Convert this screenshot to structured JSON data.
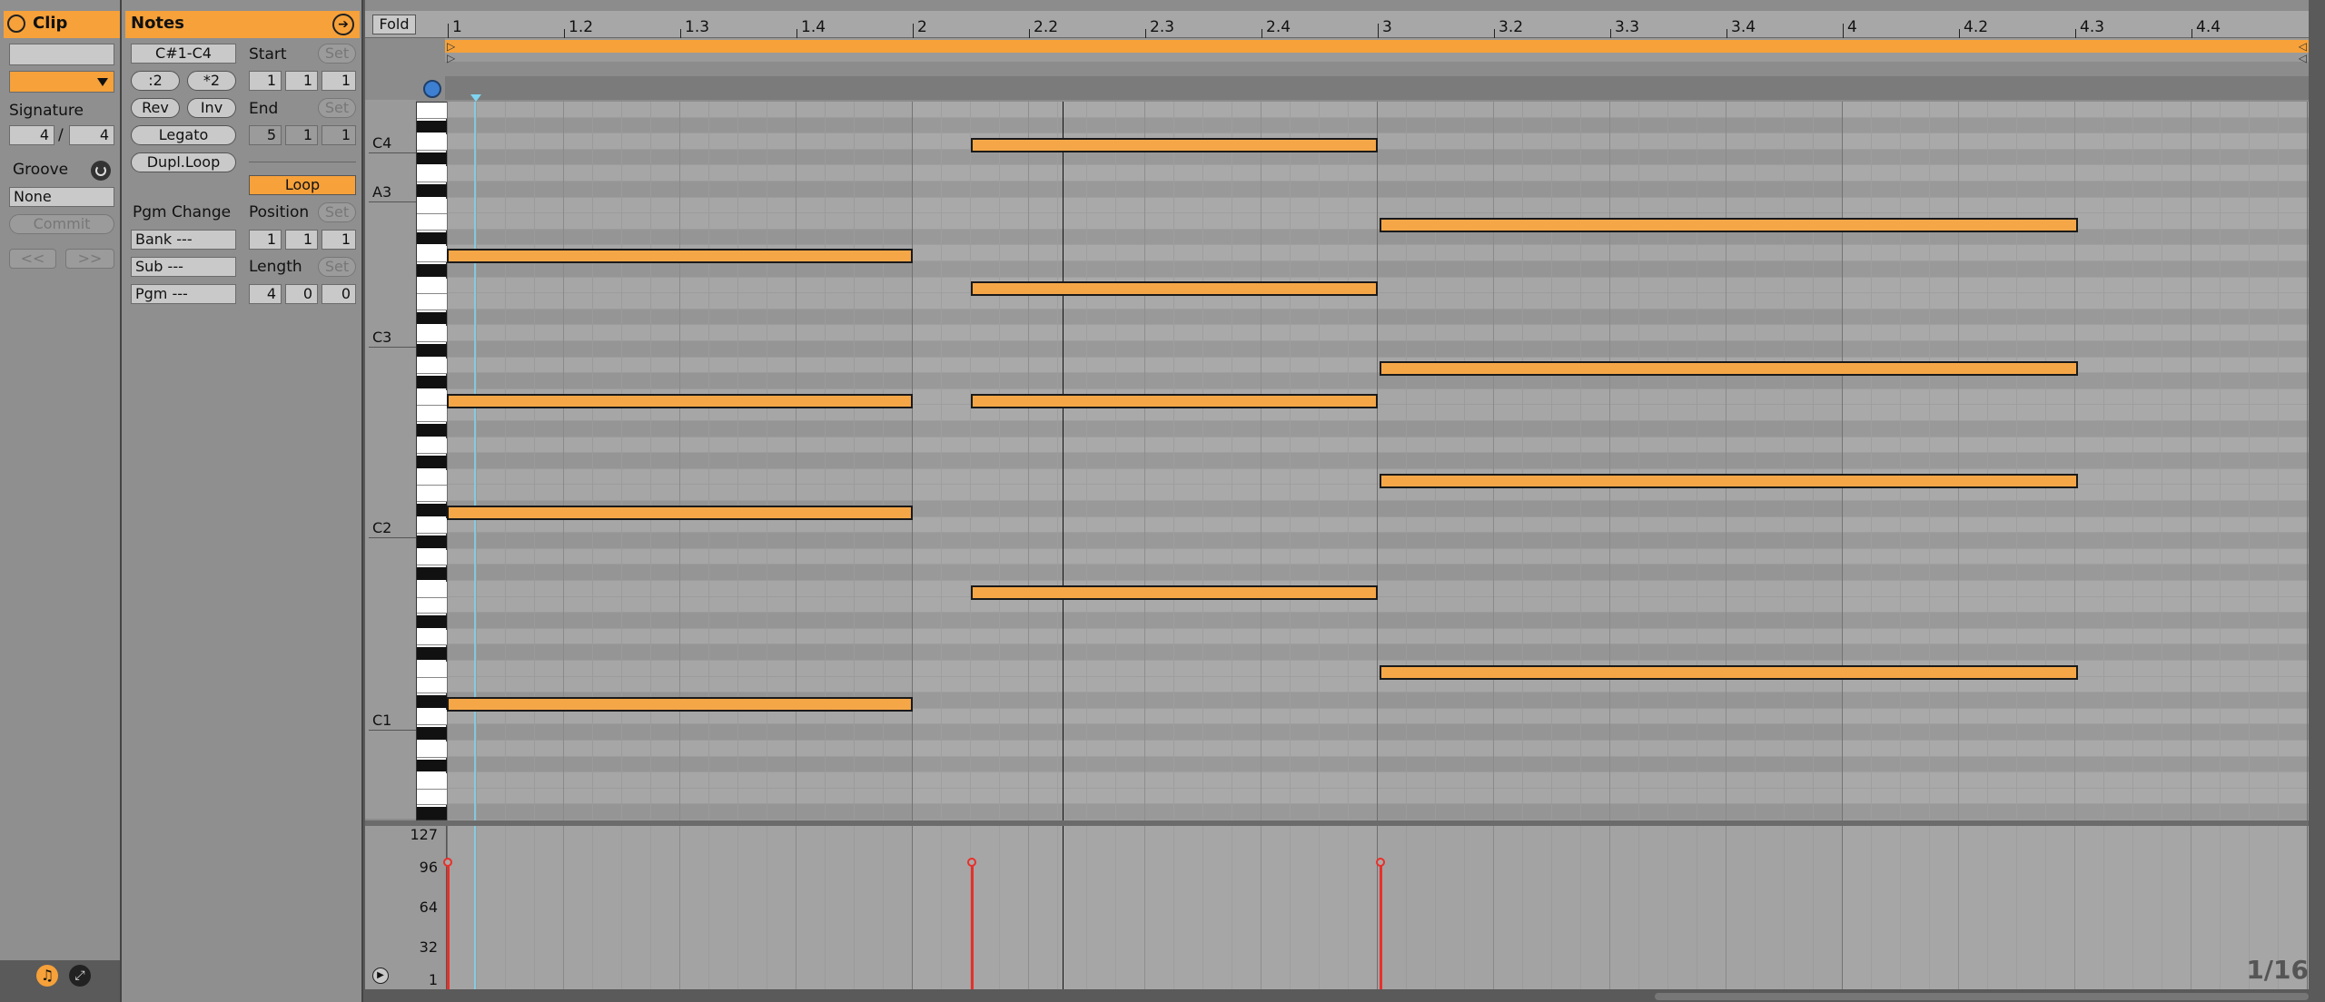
{
  "clip_panel": {
    "title": "Clip",
    "signature_label": "Signature",
    "signature_numerator": "4",
    "signature_slash": "/",
    "signature_denominator": "4",
    "groove_label": "Groove",
    "groove_value": "None",
    "commit_label": "Commit",
    "prev_label": "<<",
    "next_label": ">>"
  },
  "notes_panel": {
    "title": "Notes",
    "range": "C#1-C4",
    "half_label": ":2",
    "double_label": "*2",
    "rev_label": "Rev",
    "inv_label": "Inv",
    "legato_label": "Legato",
    "dupl_label": "Dupl.Loop",
    "pgm_change_label": "Pgm Change",
    "bank_value": "Bank ---",
    "sub_value": "Sub ---",
    "pgm_value": "Pgm ---",
    "start_label": "Start",
    "start_values": [
      "1",
      "1",
      "1"
    ],
    "end_label": "End",
    "end_values": [
      "5",
      "1",
      "1"
    ],
    "set_label": "Set",
    "loop_label": "Loop",
    "position_label": "Position",
    "position_values": [
      "1",
      "1",
      "1"
    ],
    "length_label": "Length",
    "length_values": [
      "4",
      "0",
      "0"
    ]
  },
  "editor": {
    "fold_label": "Fold",
    "ruler_labels": [
      "1",
      "1.2",
      "1.3",
      "1.4",
      "2",
      "2.2",
      "2.3",
      "2.4",
      "3",
      "3.2",
      "3.3",
      "3.4",
      "4",
      "4.2",
      "4.3",
      "4.4"
    ],
    "pitch_labels": [
      "C4",
      "A3",
      "C3",
      "C2",
      "C1"
    ],
    "grid_label": "1/16",
    "velocity_labels": [
      "127",
      "96",
      "64",
      "32",
      "1"
    ]
  },
  "colors": {
    "accent": "#f6a13a",
    "note_fill": "#f5a748",
    "velocity_stem": "#e8302a",
    "playhead": "#7fd4f0"
  }
}
